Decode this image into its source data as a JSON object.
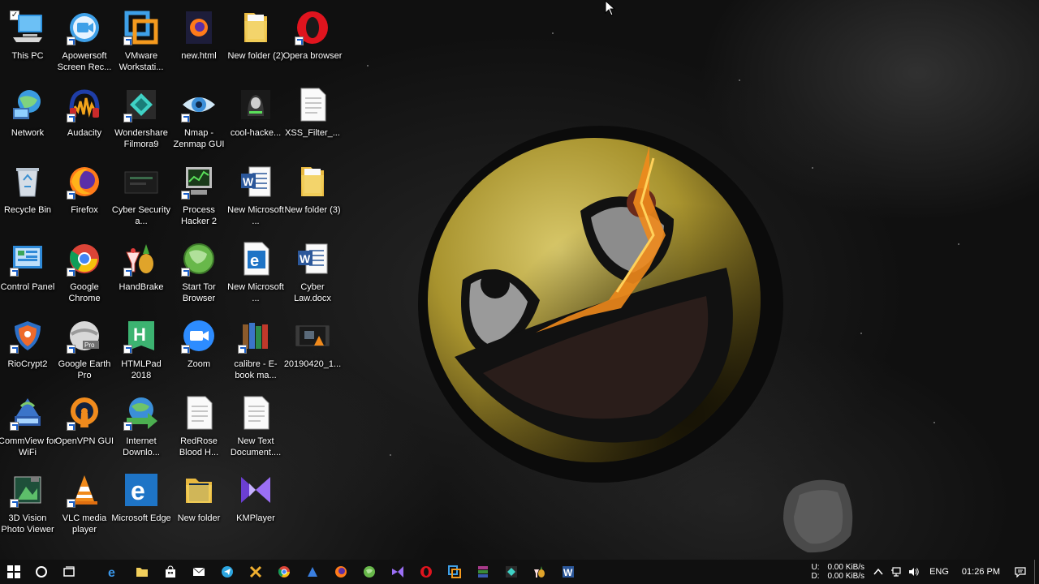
{
  "desktop": {
    "icons": [
      {
        "id": "this-pc",
        "label": "This PC"
      },
      {
        "id": "apowersoft",
        "label": "Apowersoft Screen Rec..."
      },
      {
        "id": "vmware",
        "label": "VMware Workstati..."
      },
      {
        "id": "new-html",
        "label": "new.html"
      },
      {
        "id": "new-folder-2",
        "label": "New folder (2)"
      },
      {
        "id": "opera",
        "label": "Opera browser"
      },
      {
        "id": "network",
        "label": "Network"
      },
      {
        "id": "audacity",
        "label": "Audacity"
      },
      {
        "id": "filmora",
        "label": "Wondershare Filmora9"
      },
      {
        "id": "nmap",
        "label": "Nmap - Zenmap GUI"
      },
      {
        "id": "cool-hacker",
        "label": "cool-hacke..."
      },
      {
        "id": "xss-filter",
        "label": "XSS_Filter_..."
      },
      {
        "id": "recycle-bin",
        "label": "Recycle Bin"
      },
      {
        "id": "firefox",
        "label": "Firefox"
      },
      {
        "id": "cyber-security",
        "label": "Cyber Security a..."
      },
      {
        "id": "process-hacker",
        "label": "Process Hacker 2"
      },
      {
        "id": "new-microsoft-word",
        "label": "New Microsoft ..."
      },
      {
        "id": "new-folder-3",
        "label": "New folder (3)"
      },
      {
        "id": "control-panel",
        "label": "Control Panel"
      },
      {
        "id": "google-chrome",
        "label": "Google Chrome"
      },
      {
        "id": "handbrake",
        "label": "HandBrake"
      },
      {
        "id": "tor-browser",
        "label": "Start Tor Browser"
      },
      {
        "id": "new-microsoft-edge",
        "label": "New Microsoft ..."
      },
      {
        "id": "cyber-law",
        "label": "Cyber Law.docx"
      },
      {
        "id": "riocrypt",
        "label": "RioCrypt2"
      },
      {
        "id": "google-earth",
        "label": "Google Earth Pro"
      },
      {
        "id": "htmlpad",
        "label": "HTMLPad 2018"
      },
      {
        "id": "zoom",
        "label": "Zoom"
      },
      {
        "id": "calibre",
        "label": "calibre - E-book ma..."
      },
      {
        "id": "video-file",
        "label": "20190420_1..."
      },
      {
        "id": "commview",
        "label": "CommView for WiFi"
      },
      {
        "id": "openvpn",
        "label": "OpenVPN GUI"
      },
      {
        "id": "idm",
        "label": "Internet Downlo..."
      },
      {
        "id": "redrose",
        "label": "RedRose Blood H..."
      },
      {
        "id": "new-text-doc",
        "label": "New Text Document...."
      },
      {
        "id": "vision-photo",
        "label": "3D Vision Photo Viewer"
      },
      {
        "id": "vlc",
        "label": "VLC media player"
      },
      {
        "id": "edge",
        "label": "Microsoft Edge"
      },
      {
        "id": "new-folder",
        "label": "New folder"
      },
      {
        "id": "kmplayer",
        "label": "KMPlayer"
      }
    ]
  },
  "taskbar": {
    "tray": {
      "net_up_label": "U:",
      "net_down_label": "D:",
      "speed_up": "0.00 KiB/s",
      "speed_down": "0.00 KiB/s",
      "language": "ENG",
      "clock": "01:26 PM"
    }
  },
  "colors": {
    "taskbar": "#101010",
    "edge_blue": "#1e74c6",
    "folder_yellow": "#f2cf5b"
  }
}
